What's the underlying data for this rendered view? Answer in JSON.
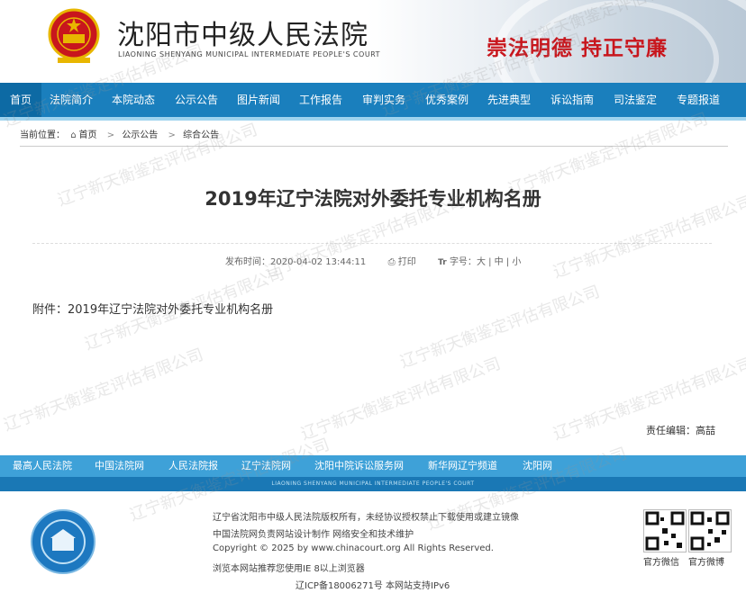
{
  "header": {
    "title": "沈阳市中级人民法院",
    "subtitle": "LIAONING SHENYANG MUNICIPAL INTERMEDIATE PEOPLE'S COURT",
    "slogan": "崇法明德  持正守廉"
  },
  "nav": {
    "items": [
      "首页",
      "法院简介",
      "本院动态",
      "公示公告",
      "图片新闻",
      "工作报告",
      "审判实务",
      "优秀案例",
      "先进典型",
      "诉讼指南",
      "司法鉴定",
      "专题报道"
    ],
    "active_index": 0,
    "color": "#1a7fbd"
  },
  "breadcrumb": {
    "label": "当前位置：",
    "items": [
      "首页",
      "公示公告",
      "综合公告"
    ]
  },
  "article": {
    "title": "2019年辽宁法院对外委托专业机构名册",
    "publish_label": "发布时间：",
    "publish_time": "2020-04-02 13:44:11",
    "print_label": "打印",
    "font_label": "字号：",
    "font_large": "大",
    "font_medium": "中",
    "font_small": "小",
    "attachment_label": "附件：",
    "attachment_name": "2019年辽宁法院对外委托专业机构名册",
    "editor": "责任编辑：高喆"
  },
  "footer_links": [
    "最高人民法院",
    "中国法院网",
    "人民法院报",
    "辽宁法院网",
    "沈阳中院诉讼服务网",
    "新华网辽宁频道",
    "沈阳网"
  ],
  "footer_sub": "LIAONING SHENYANG MUNICIPAL INTERMEDIATE PEOPLE'S COURT",
  "footer": {
    "line1": "辽宁省沈阳市中级人民法院版权所有，未经协议授权禁止下载使用或建立镜像",
    "line2": "中国法院网负责网站设计制作 网络安全和技术维护",
    "line3": "Copyright © 2025 by www.chinacourt.org All Rights Reserved.",
    "line4": "浏览本网站推荐您使用IE 8以上浏览器",
    "line5": "辽ICP备18006271号  本网站支持IPv6",
    "qr1_label": "官方微信",
    "qr2_label": "官方微博"
  },
  "watermark": "辽宁新天衡鉴定评估有限公司"
}
